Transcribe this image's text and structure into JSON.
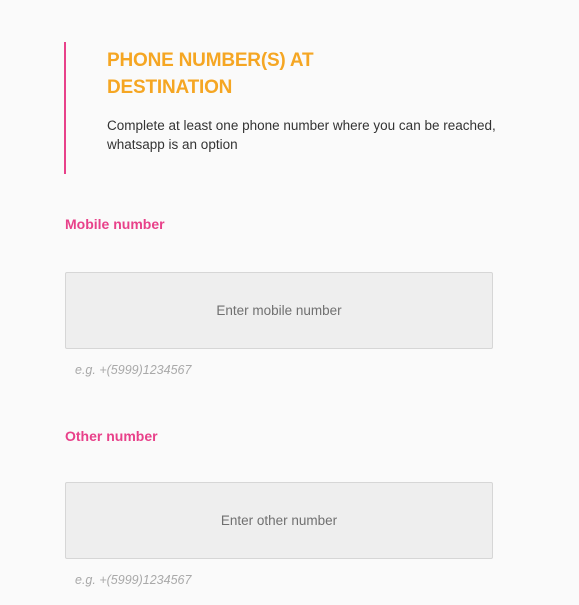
{
  "section": {
    "title": "PHONE NUMBER(S) AT DESTINATION",
    "description": "Complete at least one phone number where you can be reached, whatsapp is an option"
  },
  "fields": {
    "mobile": {
      "label": "Mobile number",
      "value": "",
      "placeholder": "Enter mobile number",
      "hint": "e.g. +(5999)1234567"
    },
    "other": {
      "label": "Other number",
      "value": "",
      "placeholder": "Enter other number",
      "hint": "e.g. +(5999)1234567"
    }
  },
  "colors": {
    "accent_pink": "#e8418a",
    "title_orange": "#f5a623",
    "input_bg": "#eeeeee",
    "hint_gray": "#a9a9a9"
  }
}
